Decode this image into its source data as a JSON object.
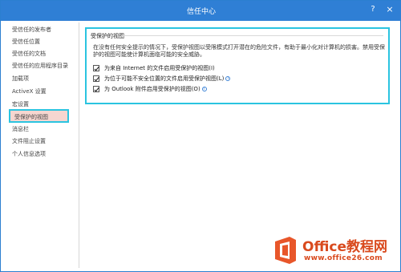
{
  "window": {
    "title": "信任中心",
    "help_glyph": "?",
    "close_glyph": "×",
    "accent_color": "#2f7fd5"
  },
  "sidebar": {
    "items": [
      {
        "label": "受信任的发布者"
      },
      {
        "label": "受信任位置"
      },
      {
        "label": "受信任的文档"
      },
      {
        "label": "受信任的应用程序目录"
      },
      {
        "label": "加载项"
      },
      {
        "label": "ActiveX 设置"
      },
      {
        "label": "宏设置"
      },
      {
        "label": "受保护的视图",
        "selected": true
      },
      {
        "label": "消息栏"
      },
      {
        "label": "文件阻止设置"
      },
      {
        "label": "个人信息选项"
      }
    ]
  },
  "protected_view": {
    "heading": "受保护的视图",
    "description": "在没有任何安全提示的情况下，受保护视图以受限模式打开潜在的危险文件，有助于最小化对计算机的损害。禁用受保护的视图可能使计算机面临可能的安全威胁。",
    "options": [
      {
        "label": "为来自 Internet 的文件启用受保护的视图(I)",
        "checked": true,
        "info": false
      },
      {
        "label": "为位于可能不安全位置的文件启用受保护视图(L)",
        "checked": true,
        "info": true
      },
      {
        "label": "为 Outlook 附件启用受保护的视图(O)",
        "checked": true,
        "info": true
      }
    ],
    "info_glyph": "i"
  },
  "watermark": {
    "brand": "Office教程网",
    "url": "www.office26.com",
    "color": "#d94a1e"
  }
}
